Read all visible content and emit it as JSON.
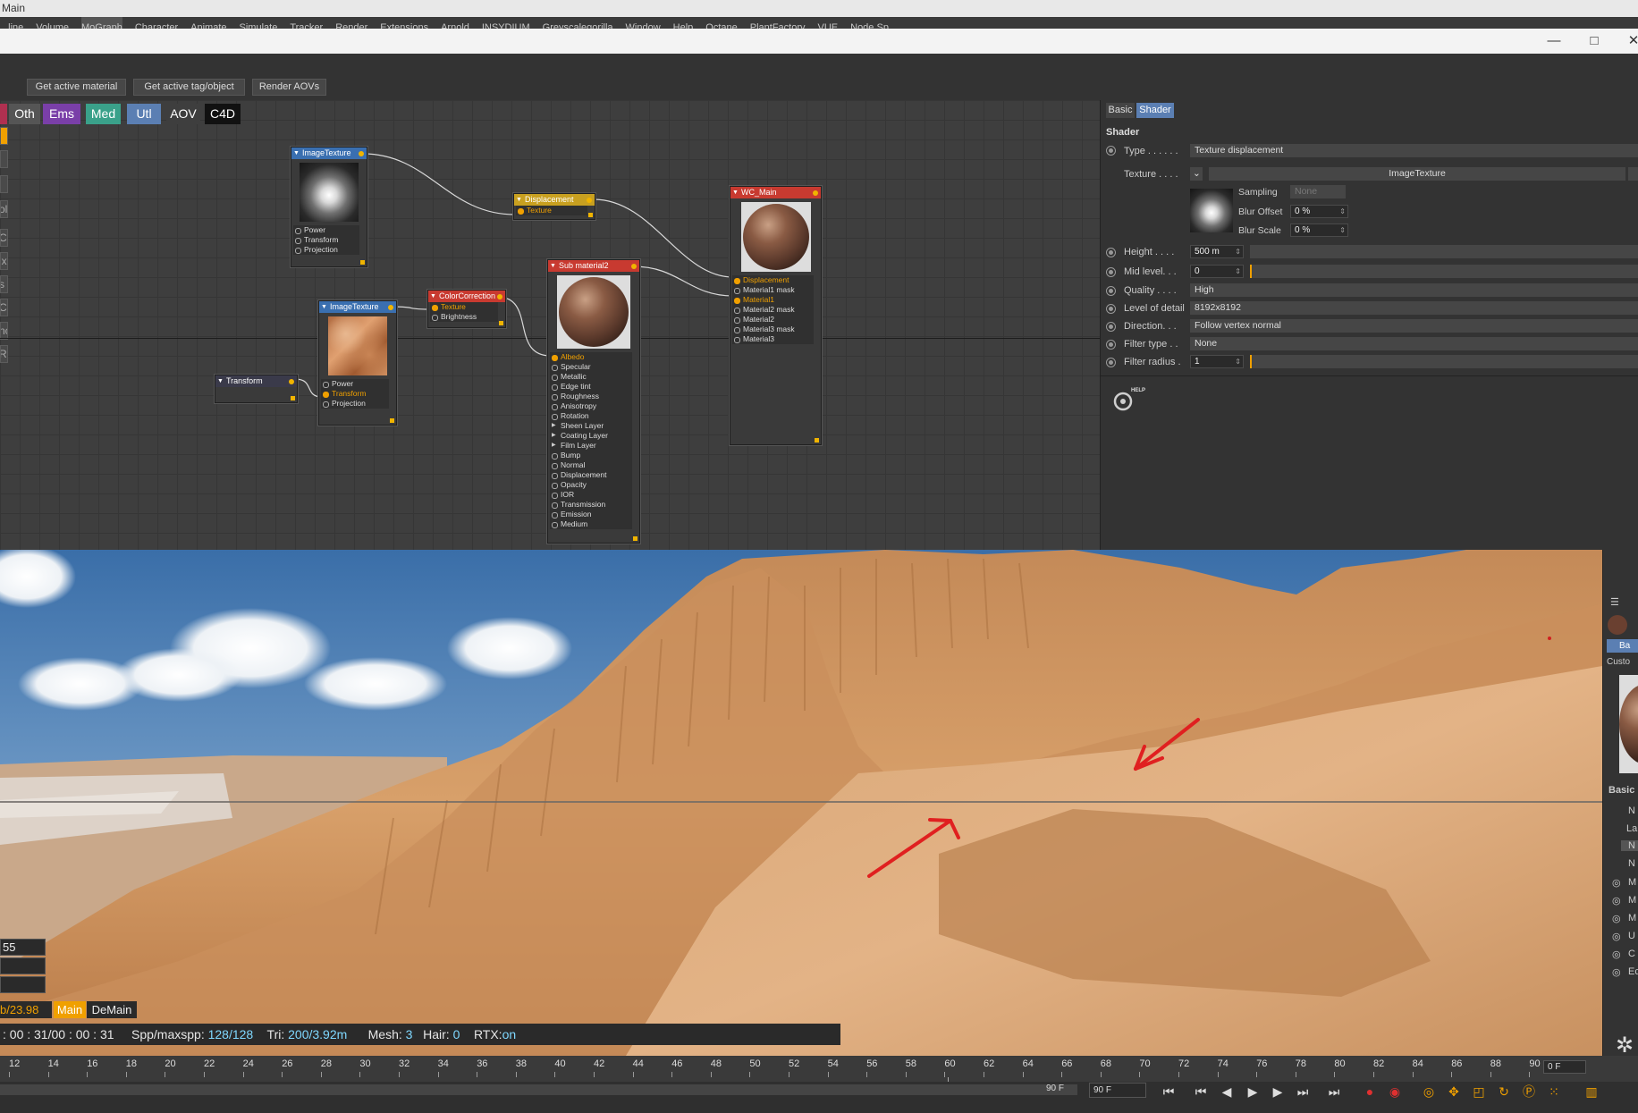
{
  "window": {
    "title": "Main"
  },
  "menu": [
    "...line",
    "Volume",
    "MoGraph",
    "Character",
    "Animate",
    "Simulate",
    "Tracker",
    "Render",
    "Extensions",
    "Arnold",
    "INSYDIUM",
    "Greyscalegorilla",
    "Window",
    "Help",
    "Octane",
    "PlantFactory",
    "VUE",
    "Node Sp..."
  ],
  "menu_active": "MoGraph",
  "window_controls": {
    "minimize": "—",
    "maximize": "□",
    "close": "✕"
  },
  "toolbar": {
    "get_active_material": "Get active material",
    "get_active_tag": "Get active tag/object",
    "render_aovs": "Render AOVs"
  },
  "categories": [
    {
      "label": "Oth",
      "color": "#555555"
    },
    {
      "label": "Ems",
      "color": "#7a3fa8"
    },
    {
      "label": "Med",
      "color": "#3aa18a"
    },
    {
      "label": "Utl",
      "color": "#5b7fb3"
    },
    {
      "label": "AOV",
      "color": "#3e3e3e"
    },
    {
      "label": "C4D",
      "color": "#111111"
    }
  ],
  "side_chips": [
    "",
    "",
    "",
    "ol",
    "CE",
    "ix",
    "s",
    "CL",
    "nc",
    "R"
  ],
  "nodes": {
    "image_texture_1": {
      "title": "ImageTexture",
      "ports": [
        "Power",
        "Transform",
        "Projection"
      ]
    },
    "displacement": {
      "title": "Displacement",
      "ports": [
        "Texture"
      ]
    },
    "wc_main": {
      "title": "WC_Main",
      "ports": [
        "Displacement",
        "Material1 mask",
        "Material1",
        "Material2 mask",
        "Material2",
        "Material3 mask",
        "Material3"
      ]
    },
    "sub_material2": {
      "title": "Sub material2",
      "ports": [
        "Albedo",
        "Specular",
        "Metallic",
        "Edge tint",
        "Roughness",
        "Anisotropy",
        "Rotation",
        "Sheen Layer",
        "Coating Layer",
        "Film Layer",
        "Bump",
        "Normal",
        "Displacement",
        "Opacity",
        "IOR",
        "Transmission",
        "Emission",
        "Medium"
      ]
    },
    "image_texture_2": {
      "title": "ImageTexture",
      "ports": [
        "Power",
        "Transform",
        "Projection"
      ]
    },
    "color_correction": {
      "title": "ColorCorrection",
      "ports": [
        "Texture",
        "Brightness"
      ]
    },
    "transform": {
      "title": "Transform"
    }
  },
  "attributes": {
    "tabs": [
      "Basic",
      "Shader"
    ],
    "section_title": "Shader",
    "type_label": "Type . . . . . .",
    "type_value": "Texture displacement",
    "texture_label": "Texture . . . .",
    "texture_value": "ImageTexture",
    "sampling_label": "Sampling",
    "sampling_value": "None",
    "blur_offset_label": "Blur Offset",
    "blur_offset_value": "0 %",
    "blur_scale_label": "Blur Scale",
    "blur_scale_value": "0 %",
    "height_label": "Height . . . .",
    "height_value": "500 m",
    "mid_label": "Mid level. . .",
    "mid_value": "0",
    "quality_label": "Quality . . . .",
    "quality_value": "High",
    "lod_label": "Level of detail",
    "lod_value": "8192x8192",
    "direction_label": "Direction. . .",
    "direction_value": "Follow vertex normal",
    "filter_type_label": "Filter type . .",
    "filter_type_value": "None",
    "filter_radius_label": "Filter radius .",
    "filter_radius_value": "1",
    "help_label": "HELP"
  },
  "viewport": {
    "stat_value": "55",
    "fps_label": "b/23.98",
    "tag_main": "Main",
    "tag_demain": "DeMain",
    "time_label": ": 00 : 31/00 : 00 : 31",
    "spp_label": "Spp/maxspp:",
    "spp_value": "128/128",
    "tri_label": "Tri:",
    "tri_value": "200/3.92m",
    "mesh_label": "Mesh:",
    "mesh_value": "3",
    "hair_label": "Hair:",
    "hair_value": "0",
    "rtx_label": "RTX:",
    "rtx_value": "on"
  },
  "side_panel": {
    "basic": "Basic",
    "custom": "Custo",
    "tab": "Ba",
    "items": [
      "N",
      "La",
      "N",
      "N",
      "M",
      "M",
      "M",
      "U",
      "C",
      "Ec"
    ]
  },
  "timeline": {
    "ticks": [
      "12",
      "14",
      "16",
      "18",
      "20",
      "22",
      "24",
      "26",
      "28",
      "30",
      "32",
      "34",
      "36",
      "38",
      "40",
      "42",
      "44",
      "46",
      "48",
      "50",
      "52",
      "54",
      "56",
      "58",
      "60",
      "62",
      "64",
      "66",
      "68",
      "70",
      "72",
      "74",
      "76",
      "78",
      "80",
      "82",
      "84",
      "86",
      "88",
      "90"
    ],
    "current_frame": "0 F",
    "end_frame_label": "90 F",
    "end_frame_field": "90 F"
  },
  "colors": {
    "accent": "#f0a000",
    "selection": "#5b7fb3",
    "annotation": "#e02020"
  }
}
